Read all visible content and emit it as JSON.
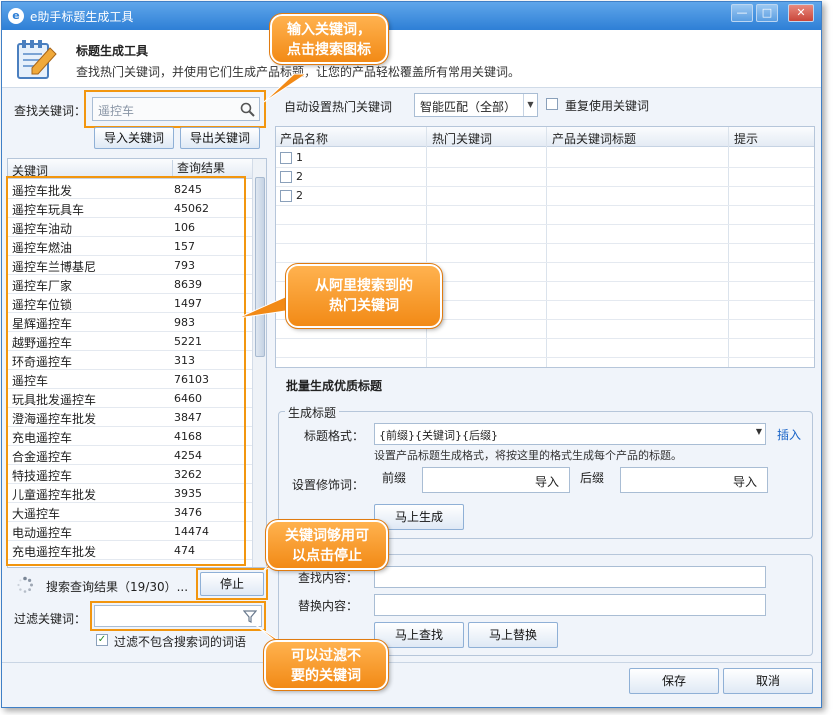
{
  "window": {
    "title": "e助手标题生成工具",
    "min": "—",
    "max": "□",
    "close": "✕"
  },
  "header": {
    "title": "标题生成工具",
    "desc": "查找热门关键词，并使用它们生成产品标题，让您的产品轻松覆盖所有常用关键词。"
  },
  "search": {
    "label": "查找关键词：",
    "value": "遥控车",
    "import_label": "导入关键词",
    "export_label": "导出关键词"
  },
  "keywords": {
    "headers": [
      "关键词",
      "查询结果"
    ],
    "rows": [
      {
        "kw": "遥控车批发",
        "n": "8245"
      },
      {
        "kw": "遥控车玩具车",
        "n": "45062"
      },
      {
        "kw": "遥控车油动",
        "n": "106"
      },
      {
        "kw": "遥控车燃油",
        "n": "157"
      },
      {
        "kw": "遥控车兰博基尼",
        "n": "793"
      },
      {
        "kw": "遥控车厂家",
        "n": "8639"
      },
      {
        "kw": "遥控车位锁",
        "n": "1497"
      },
      {
        "kw": "星辉遥控车",
        "n": "983"
      },
      {
        "kw": "越野遥控车",
        "n": "5221"
      },
      {
        "kw": "环奇遥控车",
        "n": "313"
      },
      {
        "kw": "遥控车",
        "n": "76103"
      },
      {
        "kw": "玩具批发遥控车",
        "n": "6460"
      },
      {
        "kw": "澄海遥控车批发",
        "n": "3847"
      },
      {
        "kw": "充电遥控车",
        "n": "4168"
      },
      {
        "kw": "合金遥控车",
        "n": "4254"
      },
      {
        "kw": "特技遥控车",
        "n": "3262"
      },
      {
        "kw": "儿童遥控车批发",
        "n": "3935"
      },
      {
        "kw": "大遥控车",
        "n": "3476"
      },
      {
        "kw": "电动遥控车",
        "n": "14474"
      },
      {
        "kw": "充电遥控车批发",
        "n": "474"
      }
    ]
  },
  "progress": {
    "text": "搜索查询结果（19/30）...",
    "stop_label": "停止"
  },
  "filter": {
    "label": "过滤关键词：",
    "checkbox_label": "过滤不包含搜索词的词语",
    "checked": true
  },
  "auto": {
    "label": "自动设置热门关键词",
    "mode": "智能匹配（全部）",
    "repeat_label": "重复使用关键词"
  },
  "products": {
    "headers": [
      "产品名称",
      "热门关键词",
      "产品关键词标题",
      "提示"
    ],
    "rows": [
      "1",
      "2",
      "2"
    ]
  },
  "batch": {
    "title": "批量生成优质标题",
    "group1": "生成标题",
    "format_label": "标题格式：",
    "format_value": "{前缀}{关键词}{后缀}",
    "insert_label": "插入",
    "hint": "设置产品标题生成格式，将按这里的格式生成每个产品的标题。",
    "modifier_label": "设置修饰词：",
    "prefix_label": "前缀",
    "suffix_label": "后缀",
    "import_label": "导入",
    "generate_label": "马上生成"
  },
  "replace": {
    "find_label": "查找内容：",
    "replace_label": "替换内容：",
    "find_btn": "马上查找",
    "replace_btn": "马上替换"
  },
  "footer": {
    "save": "保存",
    "cancel": "取消"
  },
  "callouts": {
    "c1": [
      "输入关键词，",
      "点击搜索图标"
    ],
    "c2": [
      "从阿里搜索到的",
      "热门关键词"
    ],
    "c3": [
      "关键词够用可",
      "以点击停止"
    ],
    "c4": [
      "可以过滤不",
      "要的关键词"
    ]
  },
  "colors": {
    "accent": "#2e7fd6",
    "callout": "#f28a16",
    "link": "#1a64c8"
  }
}
